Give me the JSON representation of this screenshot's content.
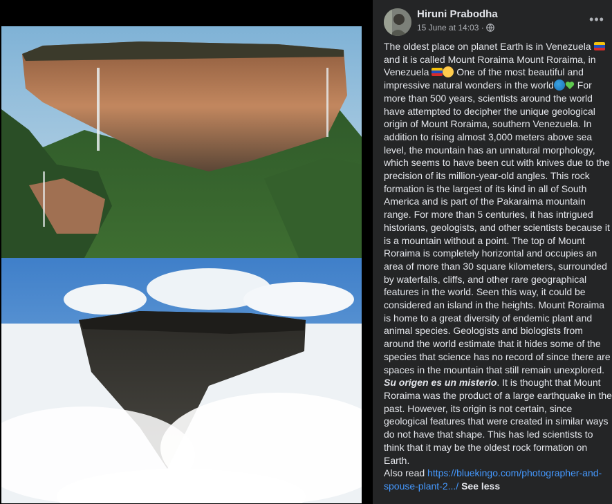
{
  "post": {
    "author": "Hiruni Prabodha",
    "timestamp": "15 June at 14:03 ·",
    "audience_icon": "globe-icon",
    "menu_icon": "more-options-icon",
    "body": {
      "part1": "The oldest place on planet Earth is in Venezuela",
      "part2": "and it is called Mount Roraima Mount Roraima, in Venezuela",
      "part3": "One of the most beautiful and impressive natural wonders in the world",
      "part4": "For more than 500 years, scientists around the world have attempted to decipher the unique geological origin of Mount Roraima, southern Venezuela. In addition to rising almost 3,000 meters above sea level, the mountain has an unnatural morphology, which seems to have been cut with knives due to the precision of its million-year-old angles. This rock formation is the largest of its kind in all of South America and is part of the Pakaraima mountain range. For more than 5 centuries, it has intrigued historians, geologists, and other scientists because it is a mountain without a point. The top of Mount Roraima is completely horizontal and occupies an area of more than 30 square kilometers, surrounded by waterfalls, cliffs, and other rare geographical features in the world. Seen this way, it could be considered an island in the heights. Mount Roraima is home to a great diversity of endemic plant and animal species. Geologists and biologists from around the world estimate that it hides some of the species that science has no record of since there are spaces in the mountain that still remain unexplored.",
      "spanish": "Su origen es un misterio",
      "part5": ". It is thought that Mount Roraima was the product of a large earthquake in the past. However, its origin is not certain, since geological features that were created in similar ways do not have that shape. This has led scientists to think that it may be the oldest rock formation on Earth.",
      "also_read": "Also read",
      "link": "https://bluekingo.com/photographer-and-spouse-plant-2.../",
      "see_less": "See less"
    }
  },
  "colors": {
    "side_bg": "#242526",
    "primary_text": "#e4e6eb",
    "secondary_text": "#b0b3b8",
    "link": "#4599ff"
  }
}
